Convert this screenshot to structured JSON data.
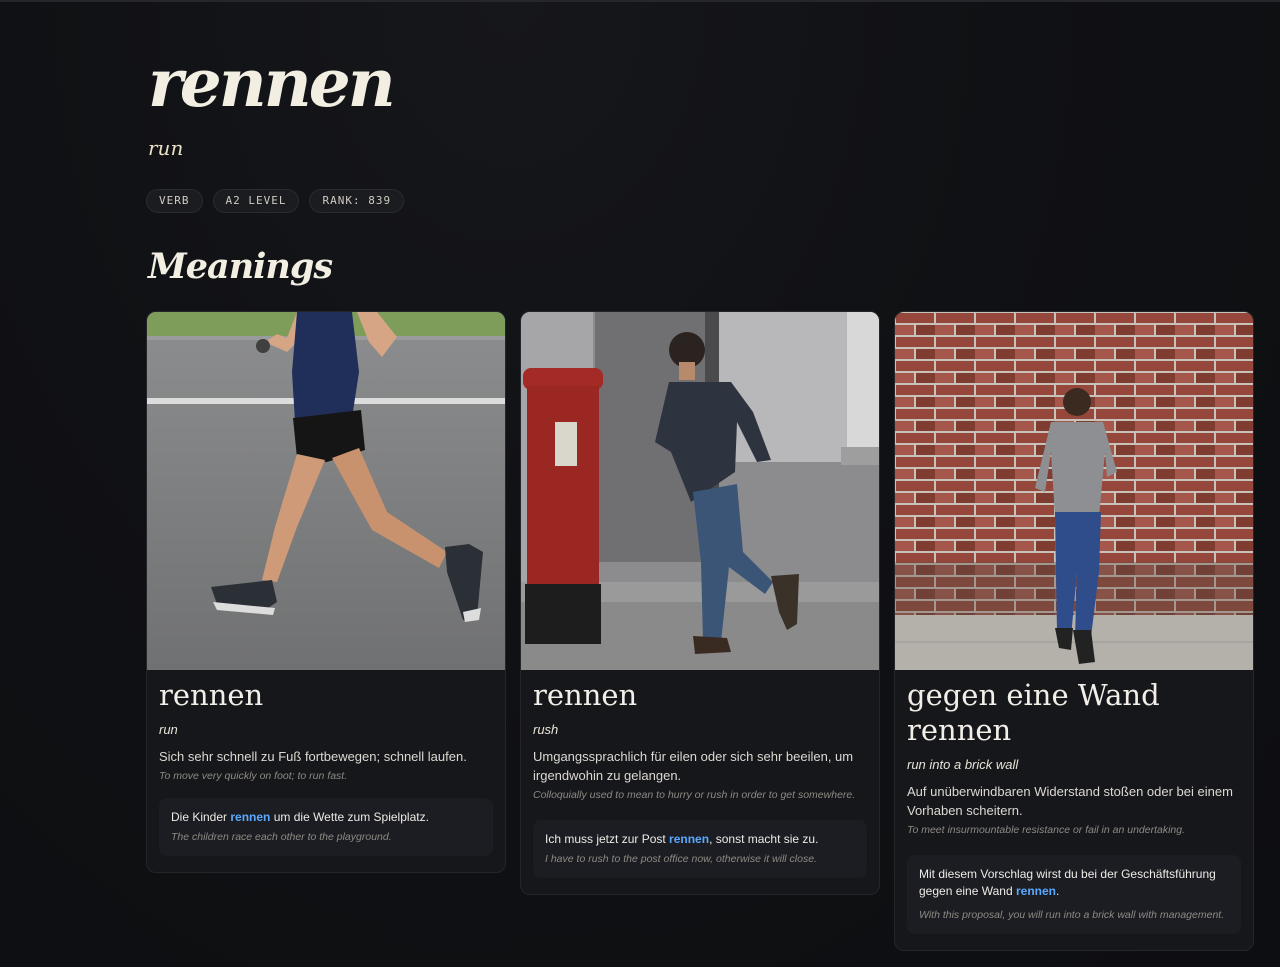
{
  "word": {
    "title": "rennen",
    "translation": "run",
    "badges": [
      "VERB",
      "A2 LEVEL",
      "RANK: 839"
    ]
  },
  "meanings_section": {
    "title": "Meanings"
  },
  "meanings": [
    {
      "heading": "rennen",
      "translation": "run",
      "definition_de": "Sich sehr schnell zu Fuß fortbewegen; schnell laufen.",
      "definition_en": "To move very quickly on foot; to run fast.",
      "example": {
        "de_before": "Die Kinder ",
        "de_highlight": "rennen",
        "de_after": " um die Wette zum Spielplatz.",
        "en": "The children race each other to the playground."
      }
    },
    {
      "heading": "rennen",
      "translation": "rush",
      "definition_de": "Umgangssprachlich für eilen oder sich sehr beeilen, um irgendwohin zu gelangen.",
      "definition_en": "Colloquially used to mean to hurry or rush in order to get somewhere.",
      "example": {
        "de_before": "Ich muss jetzt zur Post ",
        "de_highlight": "rennen",
        "de_after": ", sonst macht sie zu.",
        "en": "I have to rush to the post office now, otherwise it will close."
      }
    },
    {
      "heading": "gegen eine Wand rennen",
      "translation": "run into a brick wall",
      "definition_de": "Auf unüberwindbaren Widerstand stoßen oder bei einem Vorhaben scheitern.",
      "definition_en": "To meet insurmountable resistance or fail in an undertaking.",
      "example": {
        "de_before": "Mit diesem Vorschlag wirst du bei der Geschäftsführung gegen eine Wand ",
        "de_highlight": "rennen",
        "de_after": ".",
        "en": "With this proposal, you will run into a brick wall with management."
      }
    }
  ],
  "colors": {
    "background": "#0f1013",
    "card": "#16171b",
    "highlight": "#5aa9ff",
    "title": "#f3eee2"
  }
}
